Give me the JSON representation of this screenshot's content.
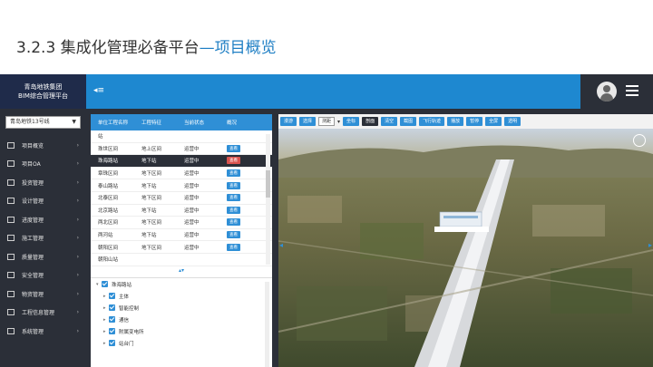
{
  "slide": {
    "title_prefix": "3.2.3 集成化管理必备平台",
    "title_highlight": "—项目概览"
  },
  "app": {
    "logo_line1": "青岛地铁集团",
    "logo_line2": "BIM综合管理平台",
    "menu_toggle": "◂≡",
    "line_select": "青岛地铁13号线",
    "nav": [
      {
        "label": "项目概览",
        "icon": "monitor-icon"
      },
      {
        "label": "项目OA",
        "icon": "keyboard-icon"
      },
      {
        "label": "投资管理",
        "icon": "wallet-icon"
      },
      {
        "label": "设计管理",
        "icon": "edit-icon"
      },
      {
        "label": "进度管理",
        "icon": "flag-icon"
      },
      {
        "label": "施工管理",
        "icon": "construction-icon"
      },
      {
        "label": "质量管理",
        "icon": "quality-icon"
      },
      {
        "label": "安全管理",
        "icon": "safety-icon"
      },
      {
        "label": "物资管理",
        "icon": "box-icon"
      },
      {
        "label": "工程信息管理",
        "icon": "user-icon"
      },
      {
        "label": "系统管理",
        "icon": "gear-icon"
      }
    ]
  },
  "grid": {
    "headers": [
      "单位工程名称",
      "工程特征",
      "当前状态",
      "概况"
    ],
    "rows": [
      {
        "name": "站",
        "feature": "",
        "status": "",
        "view": "",
        "red": false,
        "sel": false
      },
      {
        "name": "珠世区间",
        "feature": "地上区间",
        "status": "运营中",
        "view": "查看",
        "red": false,
        "sel": false
      },
      {
        "name": "珠海路站",
        "feature": "地下站",
        "status": "运营中",
        "view": "查看",
        "red": true,
        "sel": true
      },
      {
        "name": "章珠区间",
        "feature": "地下区间",
        "status": "运营中",
        "view": "查看",
        "red": false,
        "sel": false
      },
      {
        "name": "泰山路站",
        "feature": "地下站",
        "status": "运营中",
        "view": "查看",
        "red": false,
        "sel": false
      },
      {
        "name": "北泰区间",
        "feature": "地下区间",
        "status": "运营中",
        "view": "查看",
        "red": false,
        "sel": false
      },
      {
        "name": "北京路站",
        "feature": "地下站",
        "status": "运营中",
        "view": "查看",
        "red": false,
        "sel": false
      },
      {
        "name": "两北区间",
        "feature": "地下区间",
        "status": "运营中",
        "view": "查看",
        "red": false,
        "sel": false
      },
      {
        "name": "两河站",
        "feature": "地下站",
        "status": "运营中",
        "view": "查看",
        "red": false,
        "sel": false
      },
      {
        "name": "朝阳区间",
        "feature": "地下区间",
        "status": "运营中",
        "view": "查看",
        "red": false,
        "sel": false
      },
      {
        "name": "朝阳山站",
        "feature": "",
        "status": "",
        "view": "",
        "red": false,
        "sel": false
      }
    ],
    "collapse": "▴▾"
  },
  "tree": {
    "root": "珠海路站",
    "children": [
      "主体",
      "智能控制",
      "通信",
      "附属变电所",
      "站台门"
    ]
  },
  "toolbar": {
    "buttons": [
      "漫游",
      "选择"
    ],
    "select_value": "测距",
    "buttons2": [
      "坐标",
      "剖面",
      "清空",
      "截图",
      "飞行轨迹",
      "播放",
      "暂停",
      "全屏",
      "透明"
    ]
  },
  "colors": {
    "accent": "#1e88d0",
    "dark": "#2b2f38",
    "alert": "#d9534f"
  }
}
